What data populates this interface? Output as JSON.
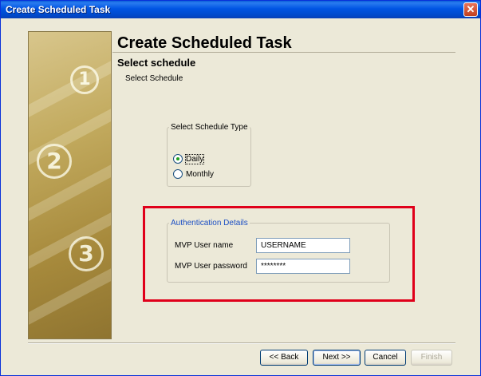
{
  "window": {
    "title": "Create Scheduled Task"
  },
  "banner": {
    "steps": [
      "1",
      "2",
      "3"
    ]
  },
  "header": {
    "title": "Create Scheduled Task",
    "subtitle": "Select schedule",
    "description": "Select Schedule"
  },
  "schedule_type": {
    "legend": "Select Schedule Type",
    "options": [
      {
        "label": "Daily",
        "selected": true
      },
      {
        "label": "Monthly",
        "selected": false
      }
    ]
  },
  "auth": {
    "legend": "Authentication Details",
    "username_label": "MVP User name",
    "username_value": "USERNAME",
    "password_label": "MVP User password",
    "password_value": "********"
  },
  "buttons": {
    "back": "<< Back",
    "next": "Next >>",
    "cancel": "Cancel",
    "finish": "Finish"
  },
  "colors": {
    "highlight": "#e0001a",
    "titlebar": "#0054e3",
    "window_bg": "#ece9d8"
  }
}
